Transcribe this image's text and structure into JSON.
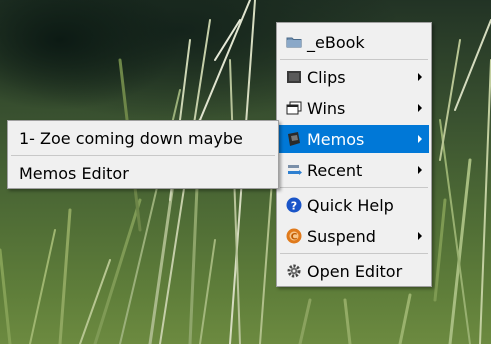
{
  "main_menu": {
    "items": [
      {
        "label": "_eBook",
        "icon": "folder-icon",
        "submenu": false
      },
      {
        "label": "Clips",
        "icon": "clips-icon",
        "submenu": true
      },
      {
        "label": "Wins",
        "icon": "windows-icon",
        "submenu": true
      },
      {
        "label": "Memos",
        "icon": "memos-icon",
        "submenu": true,
        "active": true
      },
      {
        "label": "Recent",
        "icon": "recent-icon",
        "submenu": true
      },
      {
        "label": "Quick Help",
        "icon": "help-icon",
        "submenu": false
      },
      {
        "label": "Suspend",
        "icon": "suspend-icon",
        "submenu": true
      },
      {
        "label": "Open Editor",
        "icon": "gear-icon",
        "submenu": false
      }
    ]
  },
  "memos_submenu": {
    "items": [
      {
        "label": "1- Zoe coming down maybe"
      },
      {
        "label": "Memos Editor"
      }
    ]
  },
  "colors": {
    "menu_bg": "#f0f0f0",
    "highlight": "#0078d7",
    "help_blue": "#1a55c8",
    "suspend_orange": "#e07a1c"
  }
}
